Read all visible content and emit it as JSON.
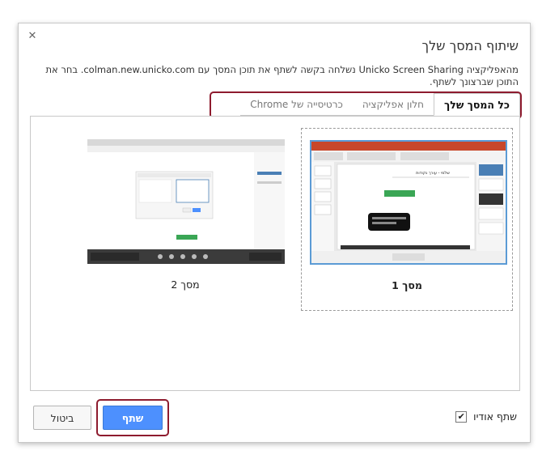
{
  "dialog": {
    "title": "שיתוף המסך שלך",
    "description": "מהאפליקציה Unicko Screen Sharing נשלחה בקשה לשתף את תוכן המסך עם colman.new.unicko.com. בחר את התוכן שברצונך לשתף.",
    "close_glyph": "✕"
  },
  "tabs": [
    {
      "label": "כל המסך שלך",
      "active": true
    },
    {
      "label": "חלון אפליקציה",
      "active": false
    },
    {
      "label": "כרטיסייה של Chrome",
      "active": false
    }
  ],
  "screens": [
    {
      "label": "מסך 1",
      "selected": true
    },
    {
      "label": "מסך 2",
      "selected": false
    }
  ],
  "thumb_text": {
    "doc_title": "שלמי - עורך נקודות",
    "green_button": "",
    "popup_line": ""
  },
  "footer": {
    "audio_label": "שתף אודיו",
    "audio_checked": true,
    "check_glyph": "✔",
    "share_label": "שתף",
    "cancel_label": "ביטול"
  },
  "colors": {
    "accent_blue": "#4d90fe",
    "highlight_red": "#8e1b2e",
    "ppt_orange": "#c8472a"
  }
}
